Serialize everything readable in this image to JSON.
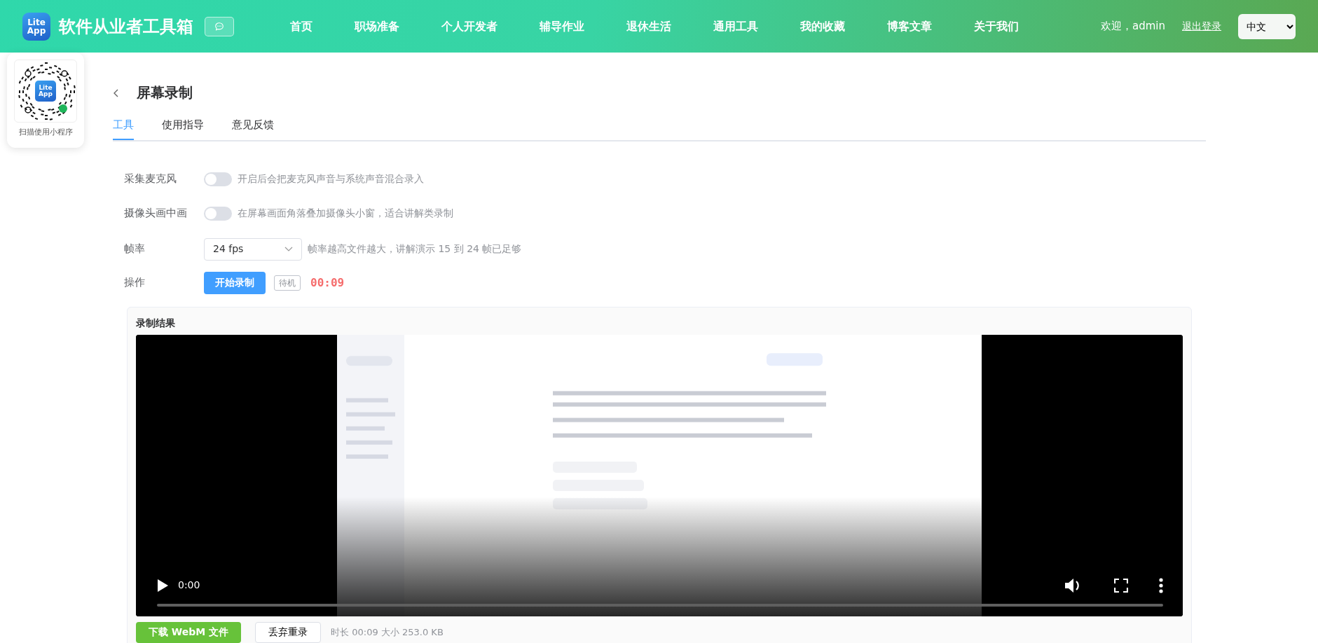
{
  "header": {
    "logo_lines": [
      "Lite",
      "App"
    ],
    "site_title": "软件从业者工具箱",
    "nav": [
      {
        "label": "首页"
      },
      {
        "label": "职场准备"
      },
      {
        "label": "个人开发者"
      },
      {
        "label": "辅导作业"
      },
      {
        "label": "退休生活"
      },
      {
        "label": "通用工具"
      },
      {
        "label": "我的收藏"
      },
      {
        "label": "博客文章"
      },
      {
        "label": "关于我们"
      }
    ],
    "welcome": "欢迎，admin",
    "logout": "退出登录",
    "language": "中文"
  },
  "mini_program": {
    "logo_lines": [
      "Lite",
      "App"
    ],
    "caption": "扫描使用小程序"
  },
  "page_title": "屏幕录制",
  "tabs": [
    {
      "label": "工具",
      "selected": true
    },
    {
      "label": "使用指导",
      "selected": false
    },
    {
      "label": "意见反馈",
      "selected": false
    }
  ],
  "settings": [
    {
      "kind": "toggle",
      "label": "采集麦克风",
      "on": false,
      "hint": "开启后会把麦克风声音与系统声音混合录入"
    },
    {
      "kind": "toggle",
      "label": "摄像头画中画",
      "on": false,
      "hint": "在屏幕画面角落叠加摄像头小窗，适合讲解类录制"
    },
    {
      "kind": "select",
      "label": "帧率",
      "value": "24 fps",
      "hint": "帧率越高文件越大，讲解演示 15 到 24 帧已足够"
    },
    {
      "kind": "actions",
      "label": "操作",
      "button": "开始录制",
      "status": "待机",
      "timer": "00:09"
    }
  ],
  "result": {
    "title": "录制结果",
    "video": {
      "kind": "picture",
      "time": "0:00",
      "level": 0
    },
    "download_button": "下载 WebM 文件",
    "discard_button": "丢弃重录",
    "meta": "时长 00:09  大小 253.0 KB"
  }
}
